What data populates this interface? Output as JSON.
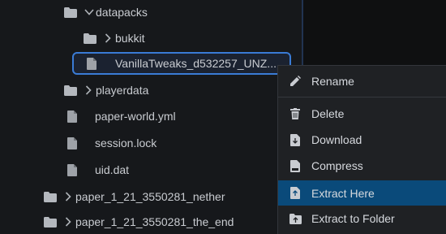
{
  "tree": {
    "items": [
      {
        "label": "datapacks",
        "type": "folder",
        "expanded": true,
        "selected": false,
        "icon": "folder-icon"
      },
      {
        "label": "bukkit",
        "type": "folder",
        "expanded": false,
        "selected": false,
        "icon": "folder-icon"
      },
      {
        "label": "VanillaTweaks_d532257_UNZ...",
        "type": "zip",
        "selected": true,
        "icon": "file-icon"
      },
      {
        "label": "playerdata",
        "type": "folder",
        "expanded": false,
        "selected": false,
        "icon": "folder-icon"
      },
      {
        "label": "paper-world.yml",
        "type": "file",
        "selected": false,
        "icon": "file-icon"
      },
      {
        "label": "session.lock",
        "type": "file",
        "selected": false,
        "icon": "file-icon"
      },
      {
        "label": "uid.dat",
        "type": "file",
        "selected": false,
        "icon": "file-icon"
      },
      {
        "label": "paper_1_21_3550281_nether",
        "type": "folder",
        "expanded": false,
        "selected": false,
        "icon": "folder-icon"
      },
      {
        "label": "paper_1_21_3550281_the_end",
        "type": "folder",
        "expanded": false,
        "selected": false,
        "icon": "folder-icon"
      }
    ]
  },
  "context_menu": {
    "items": [
      {
        "label": "Rename",
        "icon": "pencil-icon",
        "active": false
      },
      {
        "label": "Delete",
        "icon": "trash-icon",
        "active": false
      },
      {
        "label": "Download",
        "icon": "download-icon",
        "active": false
      },
      {
        "label": "Compress",
        "icon": "zip-icon",
        "active": false
      },
      {
        "label": "Extract Here",
        "icon": "extract-icon",
        "active": true
      },
      {
        "label": "Extract to Folder",
        "icon": "extract-folder-icon",
        "active": false
      }
    ]
  },
  "colors": {
    "background": "#16181b",
    "selection_border": "#3a7bd5",
    "menu_background": "#1f2124",
    "menu_active": "#0a4a7a"
  }
}
